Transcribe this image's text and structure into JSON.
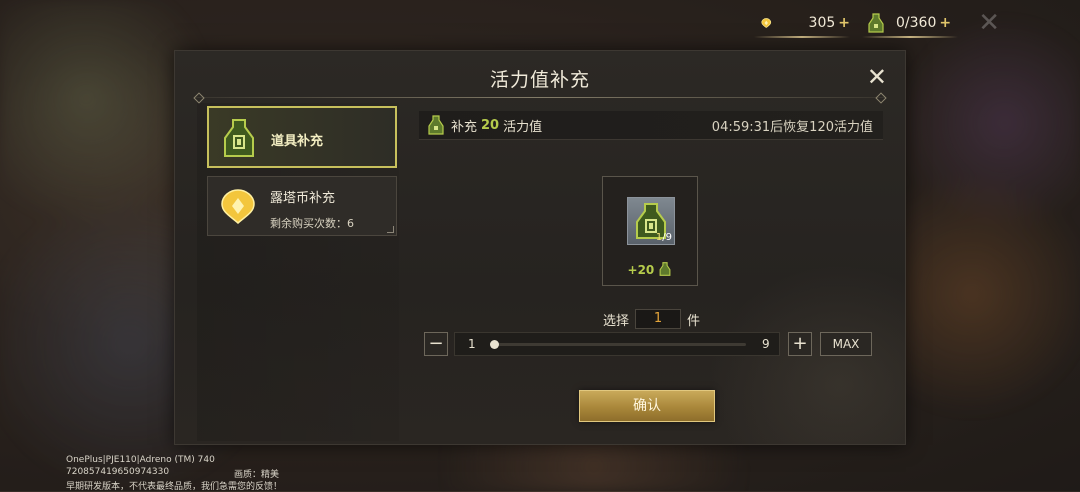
{
  "top_bar": {
    "gold": {
      "value": "305",
      "plus": "+",
      "icon": "gold-drop-icon"
    },
    "vitality": {
      "value": "0/360",
      "plus": "+",
      "icon": "vitality-potion-icon"
    }
  },
  "dialog": {
    "title": "活力值补充",
    "close_icon": "close-icon",
    "tabs": [
      {
        "label": "道具补充",
        "icon": "vitality-potion-icon",
        "active": true
      },
      {
        "label": "露塔币补充",
        "sublabel": "剩余购买次数：6",
        "icon": "gold-drop-icon",
        "active": false
      }
    ],
    "info": {
      "prefix": "补充",
      "amount": "20",
      "suffix": "活力值",
      "recover_text": "04:59:31后恢复120活力值"
    },
    "item": {
      "count_current": "1",
      "count_total": "/9",
      "gain": "+20"
    },
    "quantity": {
      "prefix": "选择",
      "value": "1",
      "suffix": "件",
      "min": "1",
      "max": "9",
      "slider_fraction": 0
    },
    "minus_label": "−",
    "plus_label": "+",
    "max_label": "MAX",
    "confirm_label": "确认"
  },
  "debug": {
    "line1": "OnePlus|PJE110|Adreno (TM) 740",
    "line2": "720857419650974330",
    "quality": "画质：精美",
    "line3": "早期研发版本，不代表最终品质，我们急需您的反馈！"
  },
  "colors": {
    "accent_green": "#b6cc4c",
    "gold": "#c9a95a",
    "active_border": "#c7c05c"
  }
}
